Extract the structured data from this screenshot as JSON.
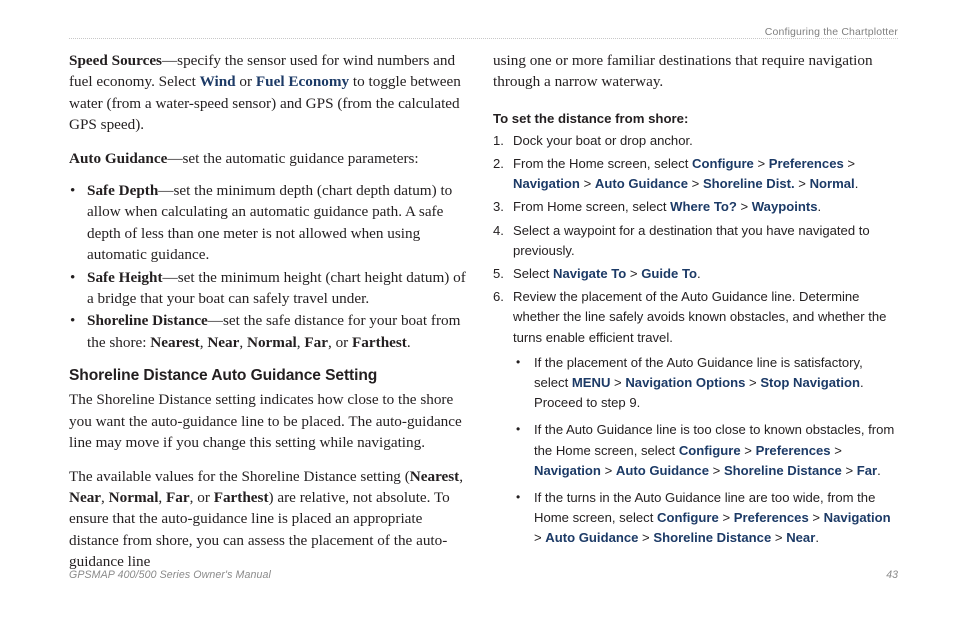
{
  "colors": {
    "body_text": "#231f20",
    "ui_term_navy": "#1c3a66",
    "header_gray": "#808080",
    "footer_gray": "#8a8a8a",
    "rule_gray": "#c8c8c8",
    "page_background": "#ffffff"
  },
  "header": {
    "running_head": "Configuring the Chartplotter"
  },
  "footer": {
    "manual_title": "GPSMAP 400/500 Series Owner's Manual",
    "page_number": "43"
  },
  "left_column": {
    "para_speed_sources": {
      "term": "Speed Sources",
      "text_1": "—specify the sensor used for wind numbers and fuel economy. Select ",
      "ui_1": "Wind",
      "text_2": " or ",
      "ui_2": "Fuel Economy",
      "text_3": " to toggle between water (from a water-speed sensor) and GPS (from the calculated GPS speed)."
    },
    "para_auto_guidance": {
      "term": "Auto Guidance",
      "text": "—set the automatic guidance parameters:"
    },
    "bullets": [
      {
        "bullet": "•",
        "term": "Safe Depth",
        "text": "—set the minimum depth (chart depth datum) to allow when calculating an automatic guidance path. A safe depth of less than one meter is not allowed when using automatic guidance."
      },
      {
        "bullet": "•",
        "term": "Safe Height",
        "text": "—set the minimum height (chart height datum) of a bridge that your boat can safely travel under."
      },
      {
        "bullet": "•",
        "term": "Shoreline Distance",
        "text_lead": "—set the safe distance for your boat from the shore: ",
        "v1": "Nearest",
        "sep1": ", ",
        "v2": "Near",
        "sep2": ", ",
        "v3": "Normal",
        "sep3": ", ",
        "v4": "Far",
        "sep4": ", or ",
        "v5": "Farthest",
        "text_end": "."
      }
    ],
    "section_heading": "Shoreline Distance Auto Guidance Setting",
    "para_shoreline_intro": "The Shoreline Distance setting indicates how close to the shore you want the auto-guidance line to be placed. The auto-guidance line may move if you change this setting while navigating.",
    "para_available_values": {
      "text_1": "The available values for the Shoreline Distance setting (",
      "v1": "Nearest",
      "sep1": ", ",
      "v2": "Near",
      "sep2": ", ",
      "v3": "Normal",
      "sep3": ", ",
      "v4": "Far",
      "sep4": ", or ",
      "v5": "Farthest",
      "text_2": ") are relative, not absolute. To ensure that the auto-guidance line is placed an appropriate distance from shore, you can assess the placement of the auto-guidance line"
    }
  },
  "right_column": {
    "continuation_text": "using one or more familiar destinations that require navigation through a narrow waterway.",
    "procedure_heading": "To set the distance from shore:",
    "steps": [
      {
        "num": "1.",
        "parts": [
          {
            "kind": "text",
            "value": "Dock your boat or drop anchor."
          }
        ]
      },
      {
        "num": "2.",
        "parts": [
          {
            "kind": "text",
            "value": "From the Home screen, select "
          },
          {
            "kind": "ui",
            "value": "Configure"
          },
          {
            "kind": "sep",
            "value": " > "
          },
          {
            "kind": "ui",
            "value": "Preferences"
          },
          {
            "kind": "sep",
            "value": " > "
          },
          {
            "kind": "ui",
            "value": "Navigation"
          },
          {
            "kind": "sep",
            "value": " > "
          },
          {
            "kind": "ui",
            "value": "Auto Guidance"
          },
          {
            "kind": "sep",
            "value": " > "
          },
          {
            "kind": "ui",
            "value": "Shoreline Dist."
          },
          {
            "kind": "sep",
            "value": " > "
          },
          {
            "kind": "ui",
            "value": "Normal"
          },
          {
            "kind": "text",
            "value": "."
          }
        ]
      },
      {
        "num": "3.",
        "parts": [
          {
            "kind": "text",
            "value": "From Home screen, select "
          },
          {
            "kind": "ui",
            "value": "Where To?"
          },
          {
            "kind": "sep",
            "value": " > "
          },
          {
            "kind": "ui",
            "value": "Waypoints"
          },
          {
            "kind": "text",
            "value": "."
          }
        ]
      },
      {
        "num": "4.",
        "parts": [
          {
            "kind": "text",
            "value": "Select a waypoint for a destination that you have navigated to previously."
          }
        ]
      },
      {
        "num": "5.",
        "parts": [
          {
            "kind": "text",
            "value": "Select "
          },
          {
            "kind": "ui",
            "value": "Navigate To"
          },
          {
            "kind": "sep",
            "value": " > "
          },
          {
            "kind": "ui",
            "value": "Guide To"
          },
          {
            "kind": "text",
            "value": "."
          }
        ]
      },
      {
        "num": "6.",
        "parts": [
          {
            "kind": "text",
            "value": "Review the placement of the Auto Guidance line. Determine whether the line safely avoids known obstacles, and whether the turns enable efficient travel."
          }
        ],
        "sub_bullets": [
          {
            "bullet": "•",
            "parts": [
              {
                "kind": "text",
                "value": "If the placement of the Auto Guidance line is satisfactory, select "
              },
              {
                "kind": "ui",
                "value": "MENU"
              },
              {
                "kind": "sep",
                "value": " > "
              },
              {
                "kind": "ui",
                "value": "Navigation Options"
              },
              {
                "kind": "sep",
                "value": " > "
              },
              {
                "kind": "ui",
                "value": "Stop Navigation"
              },
              {
                "kind": "text",
                "value": ". Proceed to step 9."
              }
            ]
          },
          {
            "bullet": "•",
            "parts": [
              {
                "kind": "text",
                "value": "If the Auto Guidance line is too close to known obstacles, from the Home screen, select "
              },
              {
                "kind": "ui",
                "value": "Configure"
              },
              {
                "kind": "sep",
                "value": " > "
              },
              {
                "kind": "ui",
                "value": "Preferences"
              },
              {
                "kind": "sep",
                "value": " > "
              },
              {
                "kind": "ui",
                "value": "Navigation"
              },
              {
                "kind": "sep",
                "value": " > "
              },
              {
                "kind": "ui",
                "value": "Auto Guidance"
              },
              {
                "kind": "sep",
                "value": " > "
              },
              {
                "kind": "ui",
                "value": "Shoreline Distance"
              },
              {
                "kind": "sep",
                "value": " > "
              },
              {
                "kind": "ui",
                "value": "Far"
              },
              {
                "kind": "text",
                "value": "."
              }
            ]
          },
          {
            "bullet": "•",
            "parts": [
              {
                "kind": "text",
                "value": "If the turns in the Auto Guidance line are too wide, from the Home screen, select "
              },
              {
                "kind": "ui",
                "value": "Configure"
              },
              {
                "kind": "sep",
                "value": " > "
              },
              {
                "kind": "ui",
                "value": "Preferences"
              },
              {
                "kind": "sep",
                "value": " > "
              },
              {
                "kind": "ui",
                "value": "Navigation"
              },
              {
                "kind": "sep",
                "value": " > "
              },
              {
                "kind": "ui",
                "value": "Auto Guidance"
              },
              {
                "kind": "sep",
                "value": " > "
              },
              {
                "kind": "ui",
                "value": "Shoreline Distance"
              },
              {
                "kind": "sep",
                "value": " > "
              },
              {
                "kind": "ui",
                "value": "Near"
              },
              {
                "kind": "text",
                "value": "."
              }
            ]
          }
        ]
      }
    ]
  }
}
